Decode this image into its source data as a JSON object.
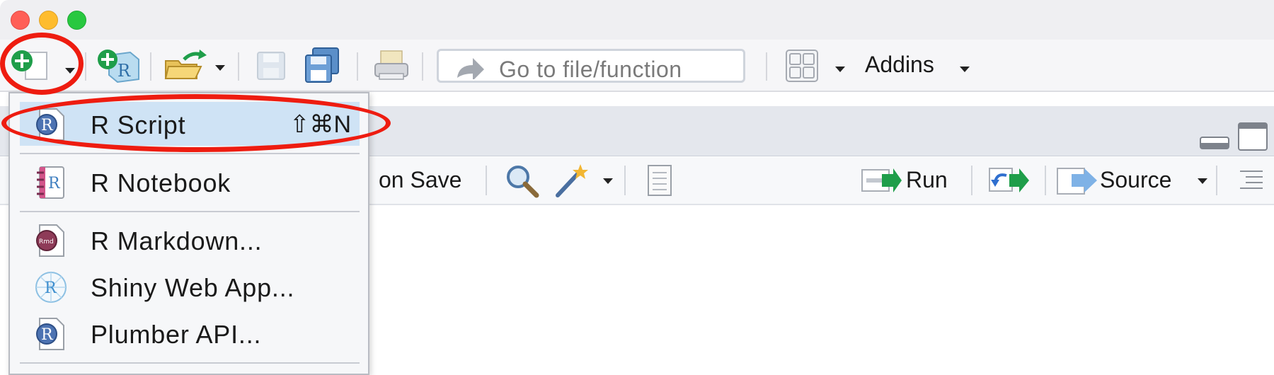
{
  "toolbar": {
    "goto_placeholder": "Go to file/function",
    "addins_label": "Addins",
    "icons": [
      "new-file-icon",
      "new-project-icon",
      "open-file-icon",
      "save-icon",
      "save-all-icon",
      "print-icon",
      "goto-arrow-icon",
      "panes-layout-icon"
    ]
  },
  "editor_toolbar": {
    "source_on_save_label": "on Save",
    "run_label": "Run",
    "source_label": "Source"
  },
  "new_file_menu": {
    "items": [
      {
        "label": "R Script",
        "shortcut": "⇧⌘N",
        "highlighted": true
      },
      {
        "label": "R Notebook"
      },
      {
        "label": "R Markdown..."
      },
      {
        "label": "Shiny Web App..."
      },
      {
        "label": "Plumber API..."
      }
    ]
  },
  "colors": {
    "annotation_red": "#ee1c10",
    "menu_highlight": "#cfe3f5",
    "plus_green": "#1f9e4a"
  }
}
